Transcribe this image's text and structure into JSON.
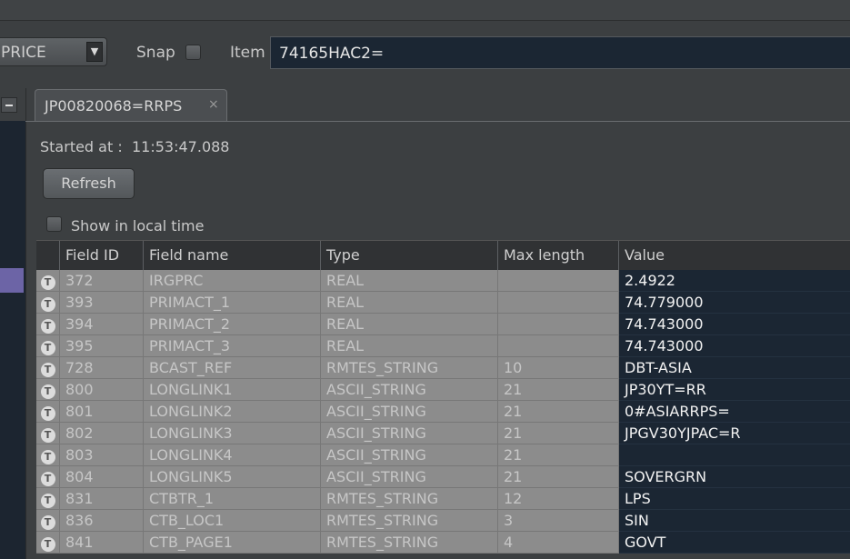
{
  "toolbar": {
    "combo_value": "PRICE",
    "snap_label": "Snap",
    "item_label": "Item",
    "item_value": "74165HAC2="
  },
  "tab": {
    "label": "JP00820068=RRPS",
    "close": "×"
  },
  "status": {
    "started_label": "Started at :",
    "started_time": "11:53:47.088"
  },
  "refresh_label": "Refresh",
  "local_time_label": "Show in local time",
  "table": {
    "headers": [
      "Field ID",
      "Field name",
      "Type",
      "Max length",
      "Value"
    ],
    "rows": [
      {
        "id": "372",
        "name": "IRGPRC",
        "type": "REAL",
        "max": "",
        "value": "2.4922"
      },
      {
        "id": "393",
        "name": "PRIMACT_1",
        "type": "REAL",
        "max": "",
        "value": "74.779000"
      },
      {
        "id": "394",
        "name": "PRIMACT_2",
        "type": "REAL",
        "max": "",
        "value": "74.743000"
      },
      {
        "id": "395",
        "name": "PRIMACT_3",
        "type": "REAL",
        "max": "",
        "value": "74.743000"
      },
      {
        "id": "728",
        "name": "BCAST_REF",
        "type": "RMTES_STRING",
        "max": "10",
        "value": "DBT-ASIA"
      },
      {
        "id": "800",
        "name": "LONGLINK1",
        "type": "ASCII_STRING",
        "max": "21",
        "value": "JP30YT=RR"
      },
      {
        "id": "801",
        "name": "LONGLINK2",
        "type": "ASCII_STRING",
        "max": "21",
        "value": "0#ASIARRPS="
      },
      {
        "id": "802",
        "name": "LONGLINK3",
        "type": "ASCII_STRING",
        "max": "21",
        "value": "JPGV30YJPAC=R"
      },
      {
        "id": "803",
        "name": "LONGLINK4",
        "type": "ASCII_STRING",
        "max": "21",
        "value": ""
      },
      {
        "id": "804",
        "name": "LONGLINK5",
        "type": "ASCII_STRING",
        "max": "21",
        "value": "SOVERGRN"
      },
      {
        "id": "831",
        "name": "CTBTR_1",
        "type": "RMTES_STRING",
        "max": "12",
        "value": "LPS"
      },
      {
        "id": "836",
        "name": "CTB_LOC1",
        "type": "RMTES_STRING",
        "max": "3",
        "value": "SIN"
      },
      {
        "id": "841",
        "name": "CTB_PAGE1",
        "type": "RMTES_STRING",
        "max": "4",
        "value": "GOVT"
      }
    ]
  },
  "icons": {
    "row_icon": "T"
  }
}
